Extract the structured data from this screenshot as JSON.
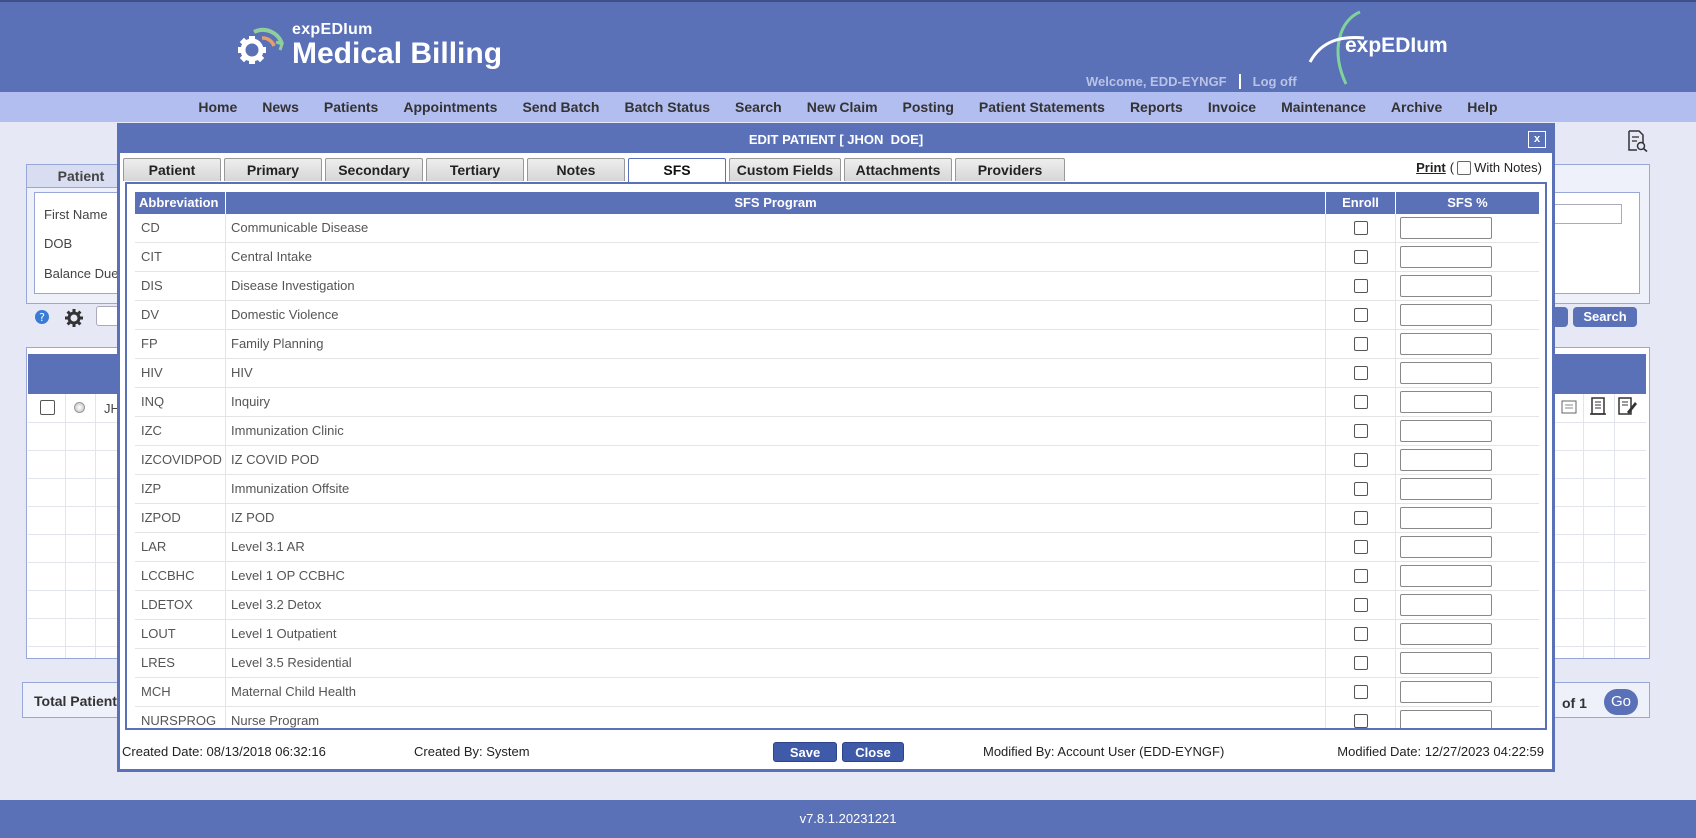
{
  "header": {
    "logo_small": "expEDIum",
    "logo_big": "Medical Billing",
    "brand_right": "expEDIum",
    "welcome": "Welcome, EDD-EYNGF",
    "logoff": "Log off"
  },
  "nav": [
    "Home",
    "News",
    "Patients",
    "Appointments",
    "Send Batch",
    "Batch Status",
    "Search",
    "New Claim",
    "Posting",
    "Patient Statements",
    "Reports",
    "Invoice",
    "Maintenance",
    "Archive",
    "Help"
  ],
  "background": {
    "tab_label": "Patient",
    "labels": [
      "First Name",
      "DOB",
      "Balance Due"
    ],
    "search_button": "Search",
    "row_name": "JH",
    "footer_left": "Total Patient",
    "footer_of": "of 1",
    "go": "Go"
  },
  "modal": {
    "title": "EDIT PATIENT [ JHON  DOE]",
    "close": "x",
    "tabs": [
      "Patient",
      "Primary",
      "Secondary",
      "Tertiary",
      "Notes",
      "SFS",
      "Custom Fields",
      "Attachments",
      "Providers"
    ],
    "active_tab": "SFS",
    "print_label": "Print",
    "print_open": "(",
    "with_notes": "With Notes)",
    "columns": {
      "abbr": "Abbreviation",
      "program": "SFS Program",
      "enroll": "Enroll",
      "pct": "SFS %"
    },
    "rows": [
      {
        "abbr": "CD",
        "program": "Communicable Disease"
      },
      {
        "abbr": "CIT",
        "program": "Central Intake"
      },
      {
        "abbr": "DIS",
        "program": "Disease Investigation"
      },
      {
        "abbr": "DV",
        "program": "Domestic Violence"
      },
      {
        "abbr": "FP",
        "program": "Family Planning"
      },
      {
        "abbr": "HIV",
        "program": "HIV"
      },
      {
        "abbr": "INQ",
        "program": "Inquiry"
      },
      {
        "abbr": "IZC",
        "program": "Immunization Clinic"
      },
      {
        "abbr": "IZCOVIDPOD",
        "program": "IZ COVID POD"
      },
      {
        "abbr": "IZP",
        "program": "Immunization Offsite"
      },
      {
        "abbr": "IZPOD",
        "program": "IZ POD"
      },
      {
        "abbr": "LAR",
        "program": "Level 3.1 AR"
      },
      {
        "abbr": "LCCBHC",
        "program": "Level 1 OP CCBHC"
      },
      {
        "abbr": "LDETOX",
        "program": "Level 3.2 Detox"
      },
      {
        "abbr": "LOUT",
        "program": "Level 1 Outpatient"
      },
      {
        "abbr": "LRES",
        "program": "Level 3.5 Residential"
      },
      {
        "abbr": "MCH",
        "program": "Maternal Child Health"
      },
      {
        "abbr": "NURSPROG",
        "program": "Nurse Program"
      }
    ],
    "footer": {
      "created_date": "Created Date: 08/13/2018 06:32:16",
      "created_by": "Created By: System",
      "save": "Save",
      "close": "Close",
      "modified_by": "Modified By: Account User (EDD-EYNGF)",
      "modified_date": "Modified Date: 12/27/2023 04:22:59"
    }
  },
  "version": "v7.8.1.20231221"
}
